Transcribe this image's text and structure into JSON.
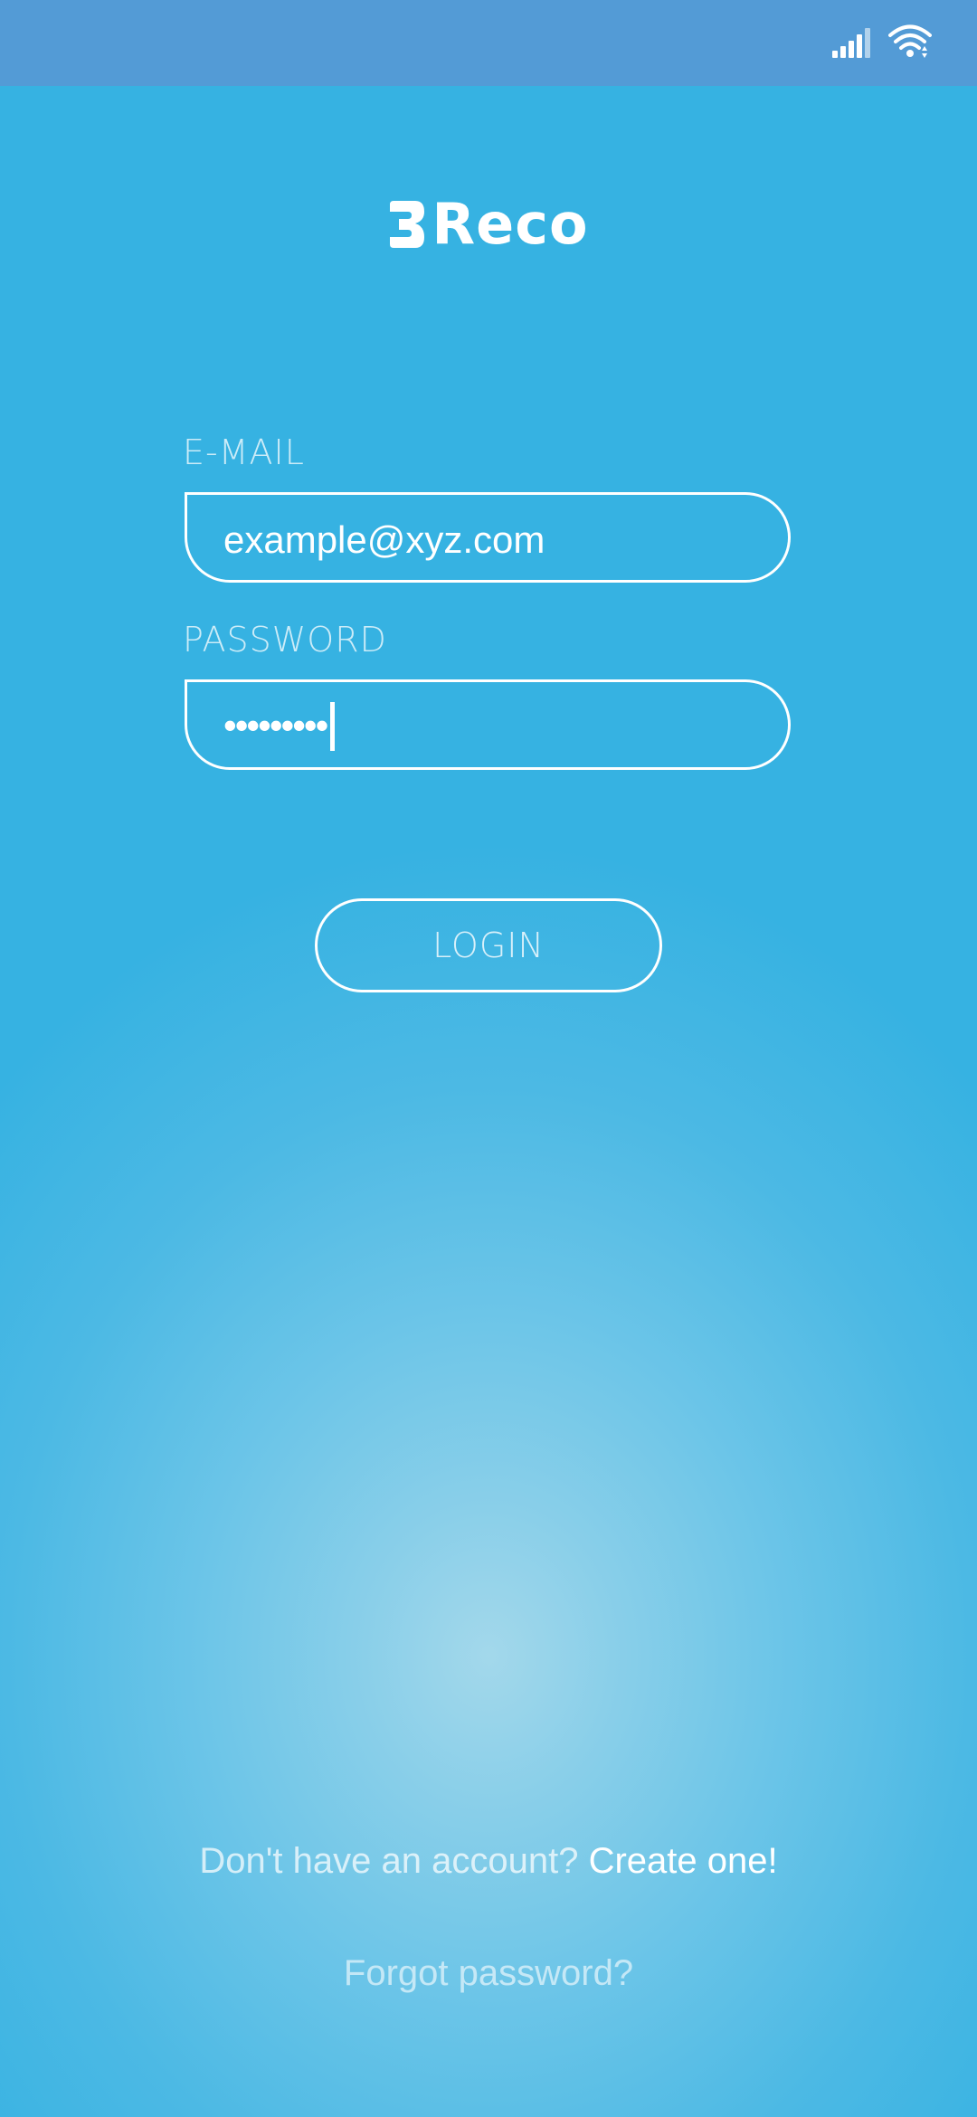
{
  "status_bar": {
    "icons": [
      "signal-icon",
      "wifi-icon"
    ]
  },
  "logo": {
    "text": "Reco",
    "mark_icon": "logo-mark-icon"
  },
  "form": {
    "email_label": "E-MAIL",
    "email_value": "example@xyz.com",
    "password_label": "PASSWORD",
    "password_value": "•••••••••"
  },
  "login_button": {
    "label": "LOGIN"
  },
  "footer": {
    "signup_prompt": "Don't have an account?",
    "signup_link": "Create one!",
    "forgot_link": "Forgot password?"
  },
  "colors": {
    "background": "#36b2e2",
    "status_bar": "#539bd6",
    "accent": "#ffffff"
  }
}
